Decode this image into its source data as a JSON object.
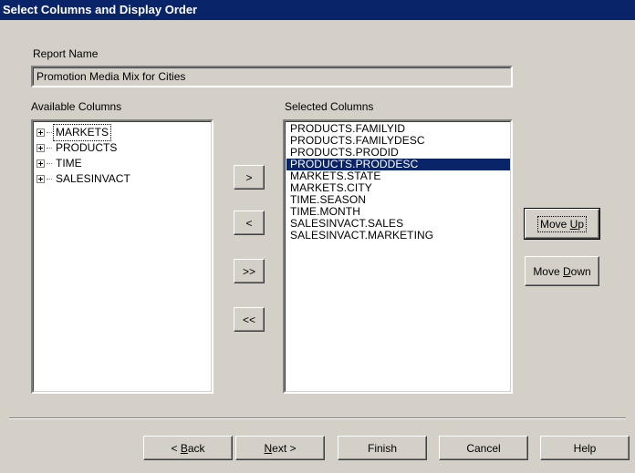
{
  "window": {
    "title": "Select Columns and Display Order"
  },
  "report_name": {
    "label": "Report Name",
    "value": "Promotion Media Mix for Cities"
  },
  "available_columns": {
    "label": "Available Columns",
    "items": [
      "MARKETS",
      "PRODUCTS",
      "TIME",
      "SALESINVACT"
    ]
  },
  "selected_columns": {
    "label": "Selected Columns",
    "items": [
      "PRODUCTS.FAMILYID",
      "PRODUCTS.FAMILYDESC",
      "PRODUCTS.PRODID",
      "PRODUCTS.PRODDESC",
      "MARKETS.STATE",
      "MARKETS.CITY",
      "TIME.SEASON",
      "TIME.MONTH",
      "SALESINVACT.SALES",
      "SALESINVACT.MARKETING"
    ],
    "selected_item": "PRODUCTS.PRODDESC"
  },
  "transfer_buttons": {
    "add": ">",
    "remove": "<",
    "add_all": ">>",
    "remove_all": "<<"
  },
  "order_buttons": {
    "move_up_prefix": "Move ",
    "move_up_accel": "U",
    "move_up_suffix": "p",
    "move_down_prefix": "Move ",
    "move_down_accel": "D",
    "move_down_suffix": "own"
  },
  "footer_buttons": {
    "back_prefix": "< ",
    "back_accel": "B",
    "back_suffix": "ack",
    "next_accel": "N",
    "next_suffix": "ext >",
    "finish": "Finish",
    "cancel": "Cancel",
    "help": "Help"
  },
  "colors": {
    "title_bar": "#0a246a",
    "dialog_face": "#d4d0c8",
    "selection_highlight": "#0a246a"
  }
}
